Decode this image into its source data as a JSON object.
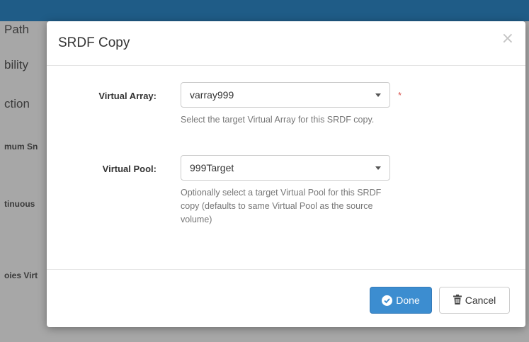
{
  "background": {
    "labels": [
      "Path",
      "Availability",
      "Protection",
      "Minimum Snapshots",
      "Continuous Copies",
      "Continuous Copies Virtual Pool"
    ],
    "visible_fragments": [
      "Path",
      "bility",
      "ction",
      "mum Sn",
      "tinuous",
      "oies Virt"
    ]
  },
  "modal": {
    "title": "SRDF Copy",
    "close_symbol": "×",
    "fields": {
      "virtual_array": {
        "label": "Virtual Array:",
        "value": "varray999",
        "required_mark": "*",
        "help": "Select the target Virtual Array for this SRDF copy."
      },
      "virtual_pool": {
        "label": "Virtual Pool:",
        "value": "999Target",
        "help": "Optionally select a target Virtual Pool for this SRDF copy (defaults to same Virtual Pool as the source volume)"
      }
    },
    "footer": {
      "done_label": "Done",
      "cancel_label": "Cancel"
    }
  },
  "colors": {
    "primary": "#3c8dd0",
    "required": "#d9534f",
    "topbar": "#1f5c87"
  },
  "icons": {
    "done": "check-circle-icon",
    "cancel": "trash-icon",
    "close": "close-icon",
    "dropdown": "chevron-down-icon"
  }
}
